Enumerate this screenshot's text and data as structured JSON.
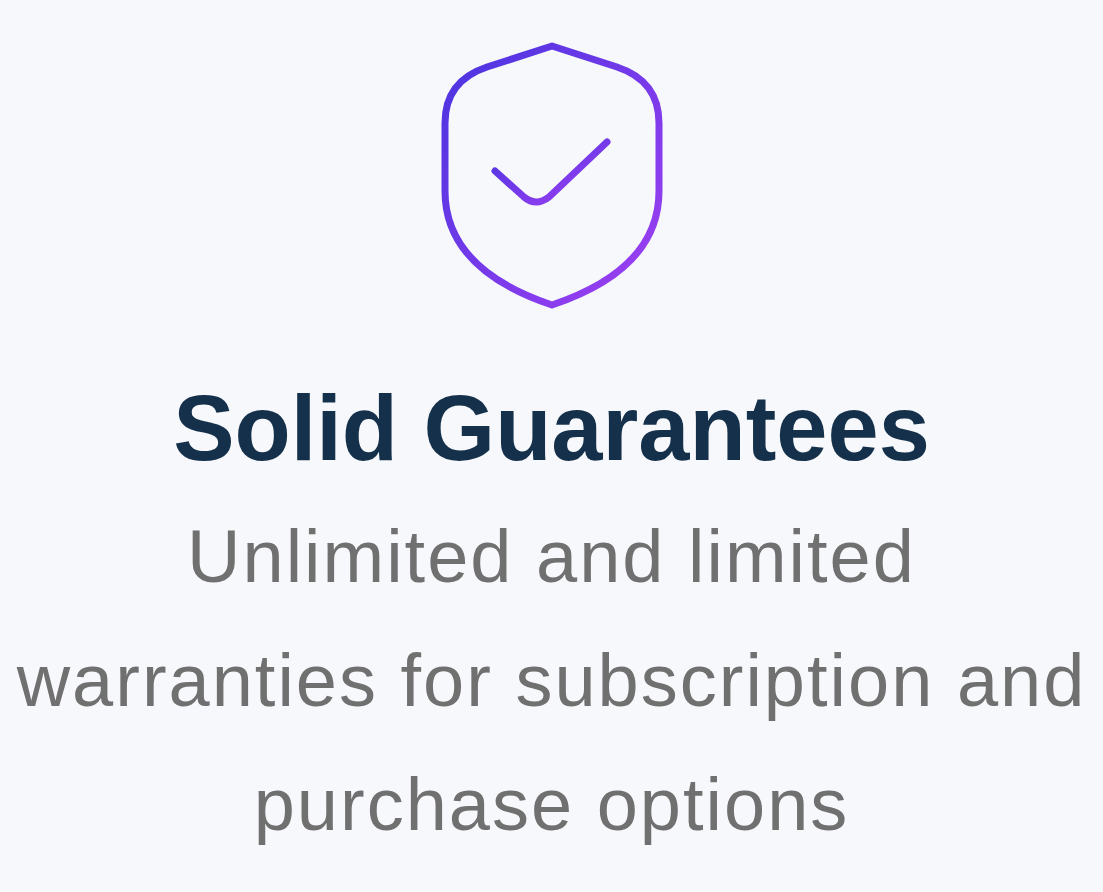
{
  "feature": {
    "title": "Solid Guarantees",
    "description": "Unlimited and limited warranties for subscription and purchase options"
  }
}
